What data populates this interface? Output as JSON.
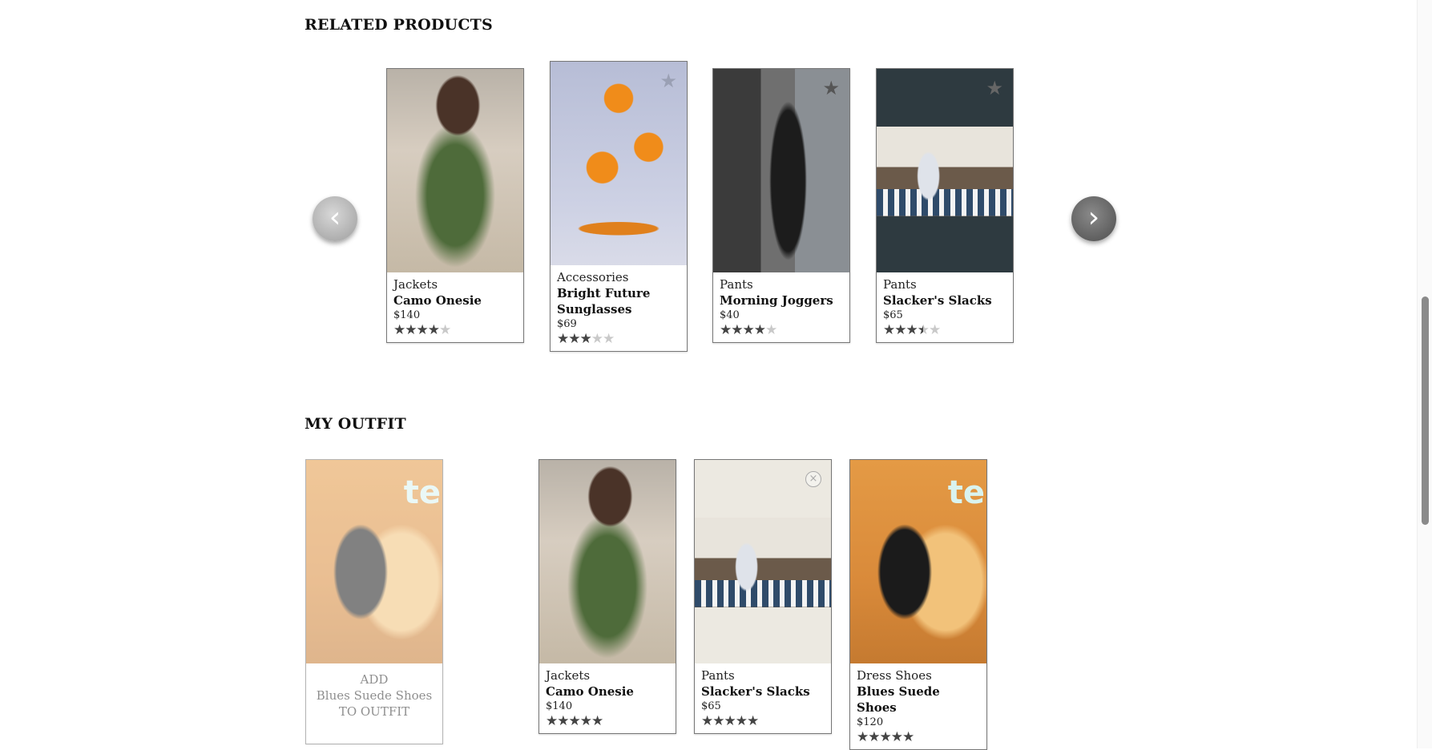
{
  "related": {
    "title": "RELATED PRODUCTS",
    "prev_arrow": "‹",
    "next_arrow": "›",
    "cards": [
      {
        "category": "Jackets",
        "name": "Camo Onesie",
        "price": "$140",
        "rating": 4,
        "image": "woman-in-camo-jacket"
      },
      {
        "category": "Accessories",
        "name": "Bright Future Sunglasses",
        "price": "$69",
        "rating": 3,
        "image": "floating-orange-slices"
      },
      {
        "category": "Pants",
        "name": "Morning Joggers",
        "price": "$40",
        "rating": 4,
        "image": "woman-in-joggers"
      },
      {
        "category": "Pants",
        "name": "Slacker's Slacks",
        "price": "$65",
        "rating": 3.5,
        "image": "man-in-cafe"
      }
    ]
  },
  "outfit": {
    "title": "MY OUTFIT",
    "add_card": {
      "line1": "ADD",
      "line2": "Blues Suede Shoes",
      "line3": "TO OUTFIT",
      "image_text": "te"
    },
    "cards": [
      {
        "category": "Jackets",
        "name": "Camo Onesie",
        "price": "$140",
        "rating": 5,
        "image": "woman-in-camo-jacket"
      },
      {
        "category": "Pants",
        "name": "Slacker's Slacks",
        "price": "$65",
        "rating": 5,
        "image": "man-in-cafe"
      },
      {
        "category": "Dress Shoes",
        "name": "Blues Suede Shoes",
        "price": "$120",
        "rating": 5,
        "image": "man-on-orange-beanbag",
        "image_text": "te"
      }
    ]
  },
  "icons": {
    "favorite": "star-icon",
    "remove": "close-circle-icon",
    "prev": "chevron-left-icon",
    "next": "chevron-right-icon"
  },
  "colors": {
    "star_on": "#444444",
    "star_off": "#c9c9c9",
    "card_border": "#777777"
  }
}
